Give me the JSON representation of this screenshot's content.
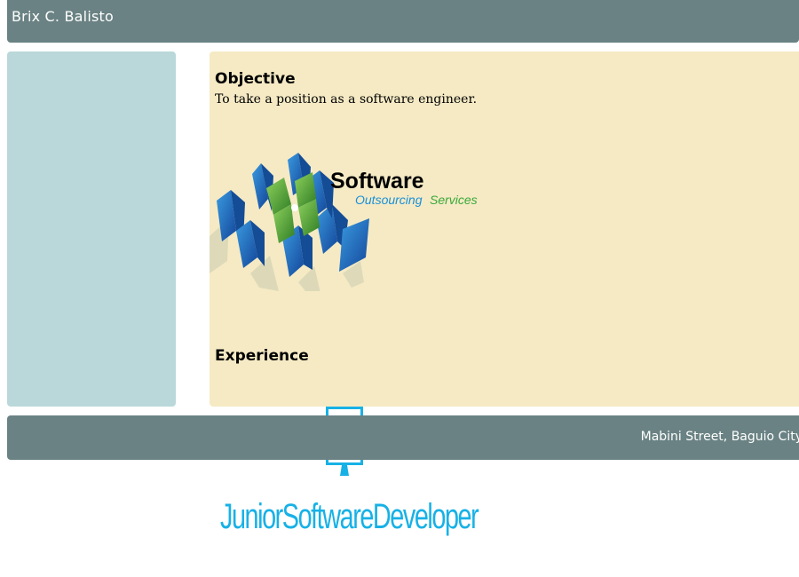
{
  "header": {
    "name": "Brix C. Balisto"
  },
  "main": {
    "objective_heading": "Objective",
    "objective_text": "To take a position as a software engineer.",
    "logo": {
      "title": "Software",
      "subtitle_part1": "Outsourcing",
      "subtitle_part2": "Services"
    },
    "experience_heading": "Experience"
  },
  "footer": {
    "address": "Mabini Street, Baguio City"
  },
  "banner": {
    "text": "JuniorSoftwareDeveloper"
  },
  "colors": {
    "header_bg": "#6a8283",
    "sidebar_bg": "#bad8da",
    "main_bg": "#f5eac4",
    "accent_cyan": "#17b1e6",
    "logo_blue": "#1f6fc0",
    "logo_green": "#5aa83a"
  }
}
